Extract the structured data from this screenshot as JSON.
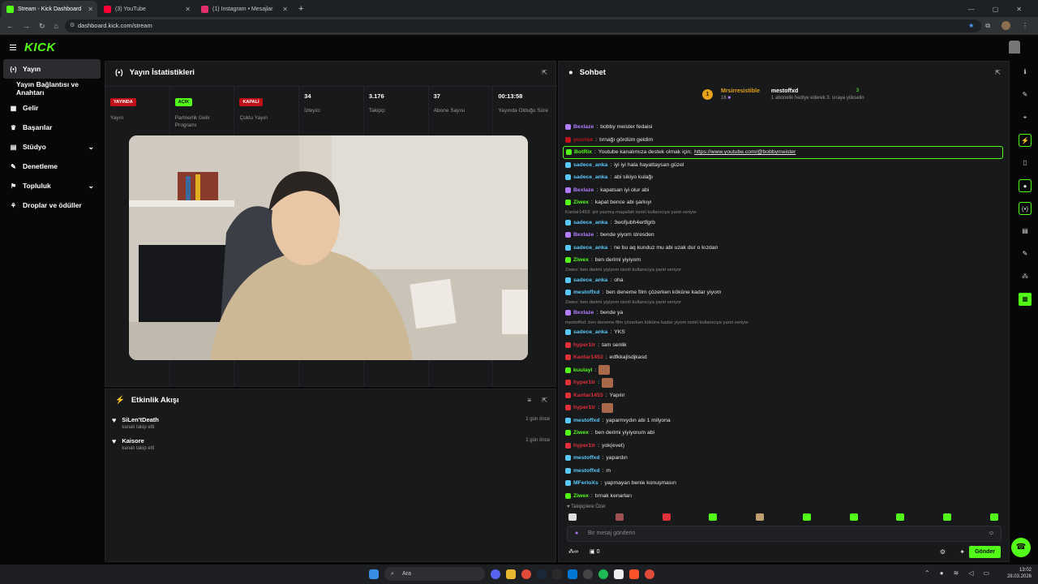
{
  "browser": {
    "tabs": [
      {
        "title": "Stream - Kick Dashboard",
        "color": "#53fc18"
      },
      {
        "title": "(3) YouTube",
        "color": "#ff0033"
      },
      {
        "title": "(1) Instagram • Mesajlar",
        "color": "#e1306c"
      }
    ],
    "url": "dashboard.kick.com/stream"
  },
  "app": {
    "logo": "KICK"
  },
  "sidebar": {
    "items": [
      {
        "label": "Yayın",
        "icon": "broadcast-icon",
        "glyph": "(•)"
      },
      {
        "label": "Yayın Bağlantısı ve Anahtarı",
        "icon": "",
        "glyph": ""
      },
      {
        "label": "Gelir",
        "icon": "revenue-icon",
        "glyph": "▦"
      },
      {
        "label": "Başarılar",
        "icon": "trophy-icon",
        "glyph": "♛"
      },
      {
        "label": "Stüdyo",
        "icon": "studio-icon",
        "glyph": "▤"
      },
      {
        "label": "Denetleme",
        "icon": "wrench-icon",
        "glyph": "✎"
      },
      {
        "label": "Topluluk",
        "icon": "community-icon",
        "glyph": "⚑"
      },
      {
        "label": "Droplar ve ödüller",
        "icon": "drops-icon",
        "glyph": "⚘"
      }
    ]
  },
  "stats": {
    "title": "Yayın İstatistikleri",
    "cells": [
      {
        "badge": "YAYINDA",
        "badge_color": "red",
        "label": "Yayın"
      },
      {
        "badge": "AÇIK",
        "badge_color": "green",
        "label": "Partnerlik Gelir Programı"
      },
      {
        "badge": "KAPALI",
        "badge_color": "red",
        "label": "Çoklu Yayın"
      },
      {
        "value": "34",
        "label": "İzleyici"
      },
      {
        "value": "3.176",
        "label": "Takipçi"
      },
      {
        "value": "37",
        "label": "Abone Sayısı"
      },
      {
        "value": "00:13:58",
        "label": "Yayında Olduğu Süre"
      }
    ]
  },
  "feed": {
    "title": "Etkinlik Akışı",
    "items": [
      {
        "name": "SiLen'tDeath",
        "action": "kanalı takip etti",
        "time": "1 gün önce"
      },
      {
        "name": "Kaisore",
        "action": "kanalı takip etti",
        "time": "1 gün önce"
      }
    ]
  },
  "chat": {
    "title": "Sohbet",
    "top_sub": {
      "name": "Mrsirresistible",
      "count": "16"
    },
    "top_gifter": {
      "name": "mestoffxd",
      "text": "1 abonelik hediye ederek 3. sıraya yükselin",
      "count": "3"
    },
    "messages": [
      {
        "user": "Bexlaze",
        "color": "#b27cff",
        "text": "bobby meister fedaisi"
      },
      {
        "user": "yourise",
        "color": "#c0101a",
        "text": "tırnağı gördüm geldim"
      },
      {
        "user": "BotRix",
        "color": "#53fc18",
        "text": "Youtube kanalımıza destek olmak için;",
        "link": "https://www.youtube.com/@bobbymeister",
        "hl": true
      },
      {
        "user": "sadece_anka",
        "color": "#5ac8fa",
        "text": "iyi iyi hala hayattaysan güzel"
      },
      {
        "user": "sadece_anka",
        "color": "#5ac8fa",
        "text": "abi sikiyo kulağı"
      },
      {
        "user": "Bexlaze",
        "color": "#b27cff",
        "text": "kapatsan iyi olur abi"
      },
      {
        "user": "Ziwex",
        "color": "#53fc18",
        "text": "kapat bence abi şarkıyı"
      },
      {
        "reply": "Kantar1453: şiir yazmış maşallah isimli kullanıcıya yanıt veriyor"
      },
      {
        "user": "sadece_anka",
        "color": "#5ac8fa",
        "text": "3wofjubh4ertfgrb"
      },
      {
        "user": "Bexlaze",
        "color": "#b27cff",
        "text": "bende yiyom stresden"
      },
      {
        "user": "sadece_anka",
        "color": "#5ac8fa",
        "text": "ne bu aq kunduz mu abi uzak dur o kızdan"
      },
      {
        "user": "Ziwex",
        "color": "#53fc18",
        "text": "ben derimi yiyiyom"
      },
      {
        "reply": "Ziwex: ben derimi yiyiyom isimli kullanıcıya yanıt veriyor"
      },
      {
        "user": "sadece_anka",
        "color": "#5ac8fa",
        "text": "oha"
      },
      {
        "user": "mestoffxd",
        "color": "#5ac8fa",
        "text": "ben deneme film çözerken kökûne kadar yiyom"
      },
      {
        "reply": "Ziwex: ben derimi yiyiyom isimli kullanıcıya yanıt veriyor"
      },
      {
        "user": "Bexlaze",
        "color": "#b27cff",
        "text": "bende ya"
      },
      {
        "reply": "mestoffxd: ben deneme film çözerken kökûne kadar yiyom isimli kullanıcıya yanıt veriyor"
      },
      {
        "user": "sadece_anka",
        "color": "#5ac8fa",
        "text": "YKS"
      },
      {
        "user": "hyper1tr",
        "color": "#e0303a",
        "text": "tam senlik"
      },
      {
        "user": "Kantar1453",
        "color": "#e0303a",
        "text": "edfkkajlsdjkasd"
      },
      {
        "user": "kuulayi",
        "color": "#53fc18",
        "text": "",
        "emote": true
      },
      {
        "user": "hyper1tr",
        "color": "#e0303a",
        "text": "",
        "emote": true
      },
      {
        "user": "Kantar1453",
        "color": "#e0303a",
        "text": "Yapılır"
      },
      {
        "user": "hyper1tr",
        "color": "#e0303a",
        "text": "",
        "emote": true
      },
      {
        "user": "mestoffxd",
        "color": "#5ac8fa",
        "text": "yaparmıydın abi 1 milyona"
      },
      {
        "user": "Ziwex",
        "color": "#53fc18",
        "text": "ben derimi yiyiyorum abi"
      },
      {
        "user": "hyper1tr",
        "color": "#e0303a",
        "text": "yok(evet)"
      },
      {
        "user": "mestoffxd",
        "color": "#5ac8fa",
        "text": "yapardın"
      },
      {
        "user": "mestoffxd",
        "color": "#5ac8fa",
        "text": "m"
      },
      {
        "user": "MFerloXs",
        "color": "#5ac8fa",
        "text": "yapmayan benle konuşmasın"
      },
      {
        "user": "Ziwex",
        "color": "#53fc18",
        "text": "tırnak kenarları"
      }
    ],
    "emote_row_label": "Takipçilere Özel",
    "input_placeholder": "Bir mesaj gönderin",
    "points": "0",
    "send_label": "Gönder"
  },
  "taskbar": {
    "search": "Ara",
    "time": "13:02",
    "date": "28.03.2026"
  },
  "colors": {
    "accent": "#53fc18",
    "panel": "#18191b",
    "bg": "#070708"
  }
}
